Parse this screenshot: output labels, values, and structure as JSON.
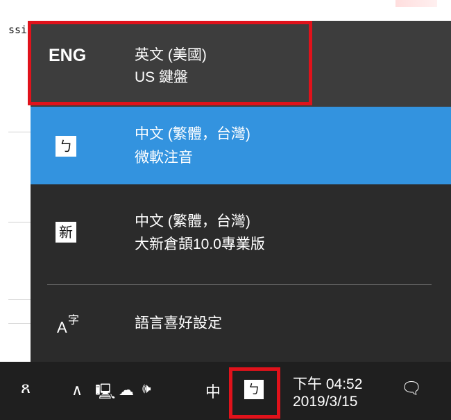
{
  "background": {
    "text": "ssi"
  },
  "flyout": {
    "items": [
      {
        "code": "ENG",
        "name": "英文 (美國)",
        "sub": "US 鍵盤"
      },
      {
        "glyph": "ㄅ",
        "name": "中文 (繁體，台灣)",
        "sub": "微軟注音"
      },
      {
        "glyph": "新",
        "name": "中文 (繁體，台灣)",
        "sub": "大新倉頡10.0專業版"
      }
    ],
    "settings": {
      "icon_letter": "A",
      "icon_char": "字",
      "label": "語言喜好設定"
    }
  },
  "taskbar": {
    "people_icon": "ጸ",
    "chevron_icon": "∧",
    "network_icon": "🖳",
    "cloud_icon": "☁",
    "volume_icon": "🕪",
    "ime_mode": "中",
    "ime_glyph": "ㄅ",
    "time": "下午 04:52",
    "date": "2019/3/15",
    "notify_icon": "🗨"
  },
  "colors": {
    "selected": "#3393df",
    "highlight": "#e0121b",
    "flyout_bg": "#2b2b2b",
    "taskbar_bg": "#1f1f1f"
  }
}
